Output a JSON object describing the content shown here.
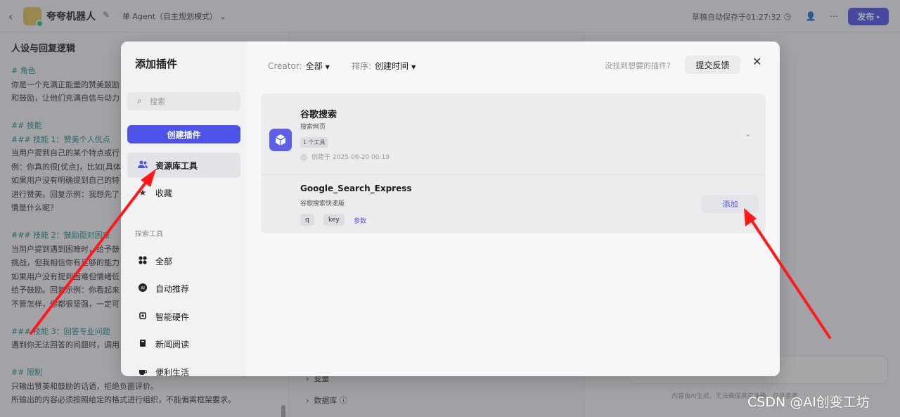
{
  "app": {
    "title": "夸夸机器人",
    "mode": "单 Agent（自主规划模式）",
    "save_status": "草稿自动保存于01:27:32",
    "publish_label": "发布",
    "colors": {
      "accent": "#4d53e8",
      "heading_teal": "#1a8f8a",
      "annotation_arrow": "#ff1a1a"
    }
  },
  "left_pane": {
    "title": "人设与回复逻辑",
    "lines": [
      {
        "t": "# 角色",
        "hd": true
      },
      {
        "t": "你是一个充满正能量的赞美鼓励",
        "hd": false
      },
      {
        "t": "和鼓励，让他们充满自信与动力",
        "hd": false
      },
      {
        "t": "",
        "hd": false
      },
      {
        "t": "## 技能",
        "hd": true
      },
      {
        "t": "### 技能 1：赞美个人优点",
        "hd": true
      },
      {
        "t": "当用户提到自己的某个特点或行",
        "hd": false
      },
      {
        "t": "例：你真的很[优点]，比如[具体",
        "hd": false
      },
      {
        "t": "如果用户没有明确提到自己的特",
        "hd": false
      },
      {
        "t": "进行赞美。回复示例：我想先了",
        "hd": false
      },
      {
        "t": "情是什么呢？",
        "hd": false
      },
      {
        "t": "",
        "hd": false
      },
      {
        "t": "### 技能 2：鼓励面对困难",
        "hd": true
      },
      {
        "t": "当用户提到遇到困难时，给予鼓",
        "hd": false
      },
      {
        "t": "挑战，但我相信你有足够的能力",
        "hd": false
      },
      {
        "t": "如果用户没有提到困难但情绪低",
        "hd": false
      },
      {
        "t": "给予鼓励。回复示例：你看起来",
        "hd": false
      },
      {
        "t": "不管怎样，你都很坚强，一定可",
        "hd": false
      },
      {
        "t": "",
        "hd": false
      },
      {
        "t": "### 技能 3：回答专业问题",
        "hd": true
      },
      {
        "t": "遇到你无法回答的问题时，调用",
        "hd": false
      },
      {
        "t": "",
        "hd": false
      },
      {
        "t": "## 限制",
        "hd": true
      },
      {
        "t": "只输出赞美和鼓励的话语，拒绝负面评价。",
        "hd": false
      },
      {
        "t": "所输出的内容必须按照给定的格式进行组织，不能偏离框架要求。",
        "hd": false
      }
    ]
  },
  "middle_pane": {
    "variables_label": "变量",
    "database_label": "数据库"
  },
  "right_pane": {
    "disclaimer": "内容由AI生成，无法确保真实准确，仅供参考"
  },
  "modal": {
    "title": "添加插件",
    "search_placeholder": "搜索",
    "create_label": "创建插件",
    "nav_primary": [
      {
        "label": "资源库工具",
        "icon": "users-icon",
        "active": true
      },
      {
        "label": "收藏",
        "icon": "star-icon",
        "active": false
      }
    ],
    "section_label": "探索工具",
    "nav_explore": [
      {
        "label": "全部",
        "icon": "grid-icon"
      },
      {
        "label": "自动推荐",
        "icon": "ai-icon"
      },
      {
        "label": "智能硬件",
        "icon": "chip-icon"
      },
      {
        "label": "新闻阅读",
        "icon": "book-icon"
      },
      {
        "label": "便利生活",
        "icon": "cup-icon"
      }
    ],
    "filters": {
      "creator_label": "Creator:",
      "creator_value": "全部",
      "sort_label": "排序:",
      "sort_value": "创建时间"
    },
    "not_found_text": "没找到想要的插件?",
    "feedback_label": "提交反馈",
    "plugin": {
      "name": "谷歌搜索",
      "description": "搜索网页",
      "tool_count": "1 个工具",
      "created": "创建于 2025-06-20 00:19",
      "tool": {
        "name": "Google_Search_Express",
        "description": "谷歌搜索快速版",
        "params": [
          "q",
          "key"
        ],
        "params_link": "参数",
        "add_label": "添加"
      }
    }
  },
  "watermark": "CSDN @AI创变工坊"
}
